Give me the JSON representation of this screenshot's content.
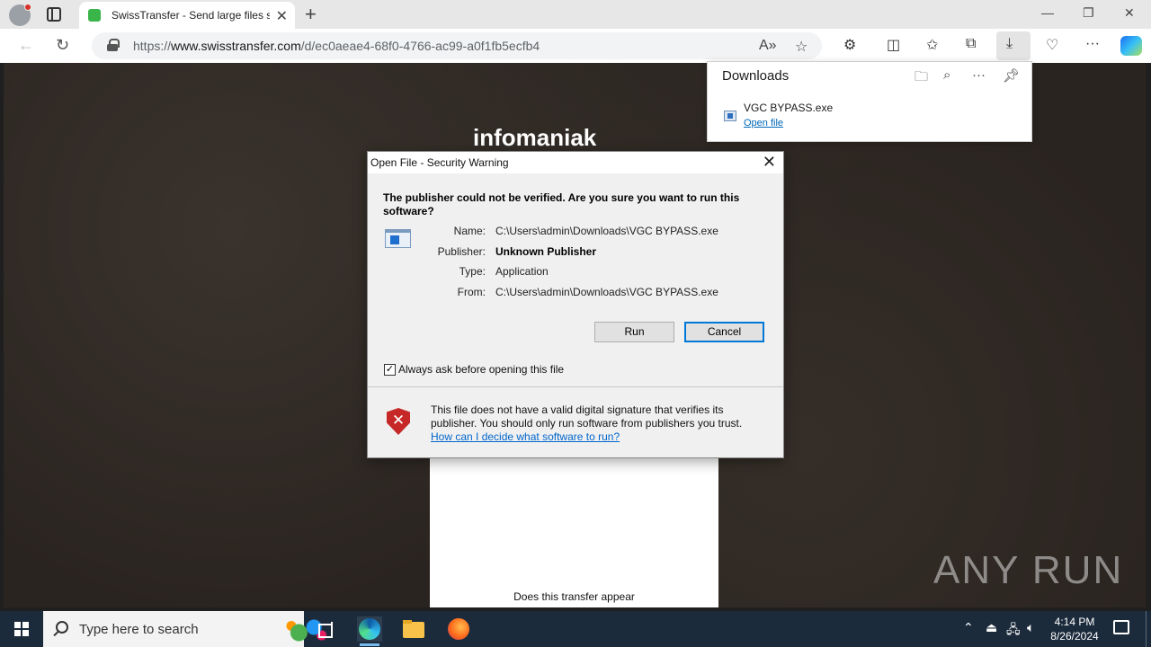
{
  "browser": {
    "tab_title": "SwissTransfer - Send large files se",
    "url_prefix": "https://",
    "url_domain": "www.swisstransfer.com",
    "url_path": "/d/ec0aeae4-68f0-4766-ac99-a0f1fb5ecfb4"
  },
  "page": {
    "brand": "infomaniak",
    "card_text": "Does this transfer appear",
    "watermark": "ANY RUN"
  },
  "downloads": {
    "title": "Downloads",
    "file_name": "VGC BYPASS.exe",
    "open_link": "Open file"
  },
  "dialog": {
    "title": "Open File - Security Warning",
    "heading": "The publisher could not be verified.  Are you sure you want to run this software?",
    "fields": [
      {
        "label": "Name:",
        "value": "C:\\Users\\admin\\Downloads\\VGC BYPASS.exe"
      },
      {
        "label": "Publisher:",
        "value": "Unknown Publisher"
      },
      {
        "label": "Type:",
        "value": "Application"
      },
      {
        "label": "From:",
        "value": "C:\\Users\\admin\\Downloads\\VGC BYPASS.exe"
      }
    ],
    "run_label": "Run",
    "cancel_label": "Cancel",
    "checkbox_label": "Always ask before opening this file",
    "checkbox_checked": true,
    "warning_text": "This file does not have a valid digital signature that verifies its publisher.  You should only run software from publishers you trust.",
    "warning_link": "How can I decide what software to run?"
  },
  "taskbar": {
    "search_placeholder": "Type here to search",
    "time": "4:14 PM",
    "date": "8/26/2024"
  }
}
